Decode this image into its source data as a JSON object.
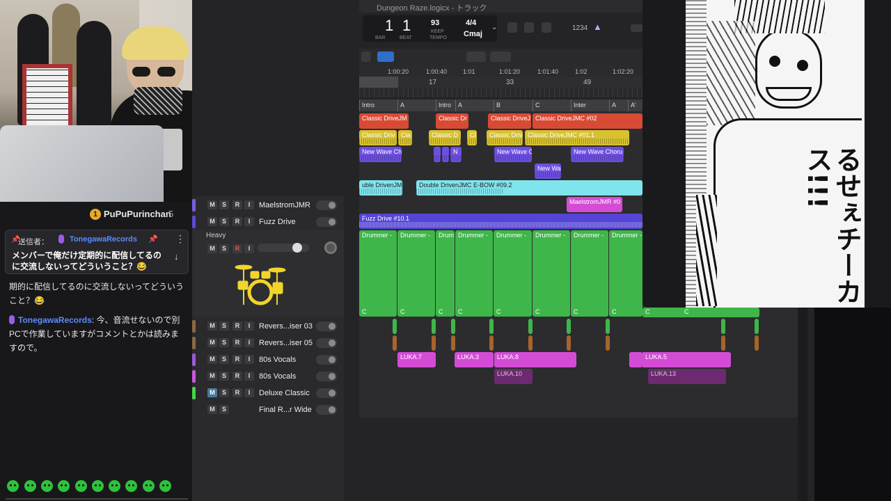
{
  "chat": {
    "gift_rank": "1",
    "gift_user": "PuPuPurinchan",
    "gift_count": "5",
    "pinned": {
      "sender_label": "送信者：",
      "sender": "TonegawaRecords",
      "message": "メンバーで俺だけ定期的に配信してるのに交流しないってどういうこと？😂"
    },
    "messages": [
      {
        "name": "",
        "text": "期的に配信してるのに交流しないってどういうこと？😂"
      },
      {
        "name": "TonegawaRecords",
        "text": ": 今、音流せないので別PCで作業していますがコメントとかは読みますので。"
      }
    ]
  },
  "daw": {
    "title": "Dungeon Raze.logicx - トラック",
    "lcd": {
      "bar": "1",
      "bar_label": "BAR",
      "beat": "1",
      "beat_label": "BEAT",
      "tempo": "93",
      "tempo_mode": "KEEP",
      "tempo_label": "TEMPO",
      "sig": "4/4",
      "key": "Cmaj",
      "count": "1234"
    },
    "ruler": {
      "times": [
        "1:00:20",
        "1:00:40",
        "1:01",
        "1:01:20",
        "1:01:40",
        "1:02",
        "1:02:20"
      ],
      "bars": [
        "17",
        "33",
        "49"
      ]
    },
    "markers": [
      "Intro",
      "A",
      "Intro",
      "A",
      "B",
      "C",
      "Inter",
      "A",
      "A'"
    ],
    "tracks": [
      {
        "name": "MaelstromJMR",
        "color": "#7b5ce0",
        "m_active": false
      },
      {
        "name": "Fuzz Drive",
        "color": "#5a4ad8",
        "m_active": false
      },
      {
        "name": "Revers...iser 03",
        "color": "#8a6a40",
        "m_active": false
      },
      {
        "name": "Revers...iser 05",
        "color": "#8a6a40",
        "m_active": false
      },
      {
        "name": "80s Vocals",
        "color": "#9a5ad8",
        "m_active": false
      },
      {
        "name": "80s Vocals",
        "color": "#c45ad8",
        "m_active": false
      },
      {
        "name": "Deluxe Classic",
        "color": "#4ad24a",
        "m_active": true
      },
      {
        "name": "Final R...r Wide",
        "color": "#666666",
        "m_active": false
      }
    ],
    "drum_track": {
      "name": "Heavy",
      "volume_fraction": 0.84
    },
    "button_labels": {
      "m": "M",
      "s": "S",
      "r": "R",
      "i": "I"
    },
    "regions": {
      "row1": [
        "Classic DriveJM",
        "Classic Dr",
        "Classic DriveJ",
        "Classic DriveJMC #02"
      ],
      "row2": [
        "Classic Driv",
        "Cla",
        "Classic D",
        "Cl",
        "Classic Driv",
        "Classic DriveJMC #01.1"
      ],
      "row3": [
        "New Wave Ch",
        "N",
        "New Wave C",
        "New Wave Choru"
      ],
      "row4": [
        "New Wa"
      ],
      "row5": [
        "uble DrivenJM",
        "Double DrivenJMC E-BOW #09.2"
      ],
      "row6": [
        "MaelstromJMR #0"
      ],
      "row7": [
        "Fuzz Drive #10.1"
      ],
      "drummer": [
        "Drummer -",
        "Drummer -",
        "Drum",
        "Drummer -",
        "Drummer -",
        "Drummer -",
        "Drummer -",
        "Drummer -"
      ],
      "drummer_c": "C",
      "luka_row1": [
        "LUKA.7",
        "LUKA.3",
        "LUKA.8",
        "LUKA.5"
      ],
      "luka_row2": [
        "LUKA.10",
        "LUKA.13"
      ]
    }
  },
  "manga": {
    "sfx": "るせぇチーカス!!!"
  }
}
